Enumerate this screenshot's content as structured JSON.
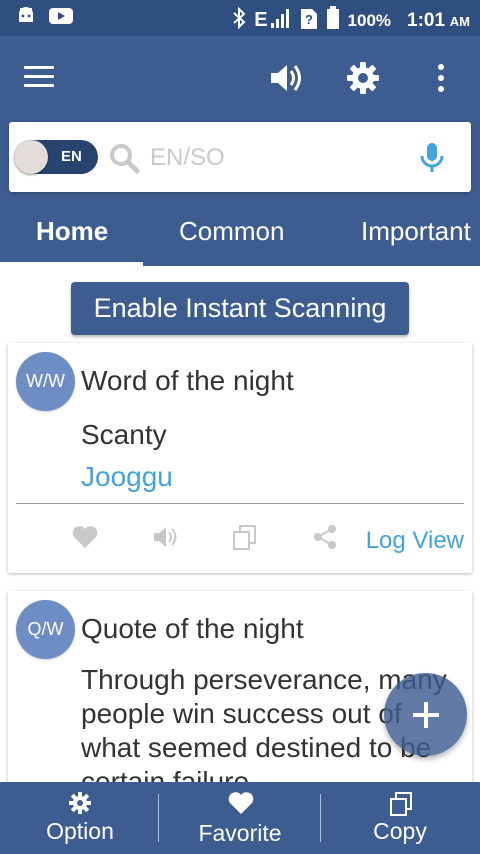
{
  "status_bar": {
    "network": "E",
    "battery": "100%",
    "time": "1:01",
    "ampm": "AM"
  },
  "app_bar": {
    "icons": [
      "menu-icon",
      "speaker-icon",
      "gear-icon",
      "more-vert-icon"
    ]
  },
  "search": {
    "toggle_label": "EN",
    "placeholder": "EN/SO",
    "value": ""
  },
  "tabs": [
    {
      "label": "Home",
      "active": true
    },
    {
      "label": "Common",
      "active": false
    },
    {
      "label": "Important",
      "active": false
    }
  ],
  "scan_button": {
    "label": "Enable Instant Scanning"
  },
  "word_card": {
    "badge": "W/W",
    "title": "Word of the night",
    "word": "Scanty",
    "translation": "Jooggu",
    "log_view": "Log View"
  },
  "quote_card": {
    "badge": "Q/W",
    "title": "Quote of the night",
    "text": "Through perseverance, many people win success out of what seemed destined to be certain failure."
  },
  "bottom_bar": {
    "option": "Option",
    "favorite": "Favorite",
    "copy": "Copy"
  },
  "colors": {
    "primary": "#3d5d91",
    "status_bar": "#2f4f80",
    "accent_link": "#44a2dc",
    "badge": "#6f8dc5"
  }
}
